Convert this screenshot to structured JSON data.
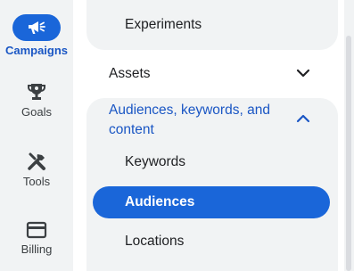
{
  "rail": {
    "items": [
      {
        "label": "Campaigns",
        "icon": "campaigns-megaphone-icon",
        "active": true
      },
      {
        "label": "Goals",
        "icon": "goals-trophy-icon",
        "active": false
      },
      {
        "label": "Tools",
        "icon": "tools-icon",
        "active": false
      },
      {
        "label": "Billing",
        "icon": "billing-card-icon",
        "active": false
      }
    ]
  },
  "nav": {
    "experiments_label": "Experiments",
    "assets_label": "Assets",
    "audiences_section_label": "Audiences, keywords, and content",
    "sub_items": [
      {
        "label": "Keywords",
        "selected": false
      },
      {
        "label": "Audiences",
        "selected": true
      },
      {
        "label": "Locations",
        "selected": false
      }
    ]
  },
  "colors": {
    "accent": "#1a66d9",
    "accent_text": "#1a56c4",
    "rail_bg": "#f1f3f4",
    "panel_bg": "#ffffff"
  }
}
